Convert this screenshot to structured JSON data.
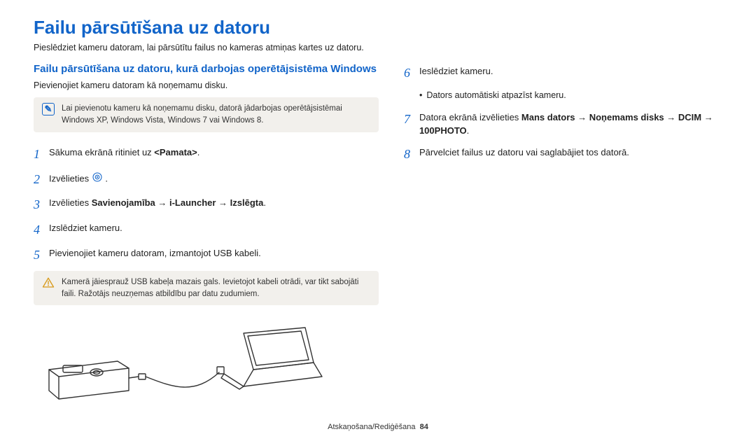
{
  "title": "Failu pārsūtīšana uz datoru",
  "intro": "Pieslēdziet kameru datoram, lai pārsūtītu failus no kameras atmiņas kartes uz datoru.",
  "left": {
    "section_title": "Failu pārsūtīšana uz datoru, kurā darbojas operētājsistēma Windows",
    "sub": "Pievienojiet kameru datoram kā noņemamu disku.",
    "info_note": "Lai pievienotu kameru kā noņemamu disku, datorā jādarbojas operētājsistēmai Windows XP, Windows Vista, Windows 7 vai Windows 8.",
    "steps": [
      {
        "num": "1",
        "pre": "Sākuma ekrānā ritiniet uz ",
        "bold": "<Pamata>",
        "post": "."
      },
      {
        "num": "2",
        "pre": "Izvēlieties ",
        "icon": "target",
        "post": "."
      },
      {
        "num": "3",
        "pre": "Izvēlieties ",
        "bold": "Savienojamība → i-Launcher → Izslēgta",
        "post": "."
      },
      {
        "num": "4",
        "pre": "Izslēdziet kameru."
      },
      {
        "num": "5",
        "pre": "Pievienojiet kameru datoram, izmantojot USB kabeli."
      }
    ],
    "warn_note": "Kamerā jāiesprauž USB kabeļa mazais gals. Ievietojot kabeli otrādi, var tikt sabojāti faili. Ražotājs neuzņemas atbildību par datu zudumiem."
  },
  "right": {
    "steps": [
      {
        "num": "6",
        "pre": "Ieslēdziet kameru."
      },
      {
        "num": "7",
        "pre": "Datora ekrānā izvēlieties ",
        "bold": "Mans dators → Noņemams disks → DCIM → 100PHOTO",
        "post": "."
      },
      {
        "num": "8",
        "pre": "Pārvelciet failus uz datoru vai saglabājiet tos datorā."
      }
    ],
    "bullets": [
      "Dators automātiski atpazīst kameru."
    ]
  },
  "footer": {
    "section": "Atskaņošana/Rediģēšana",
    "page": "84"
  }
}
